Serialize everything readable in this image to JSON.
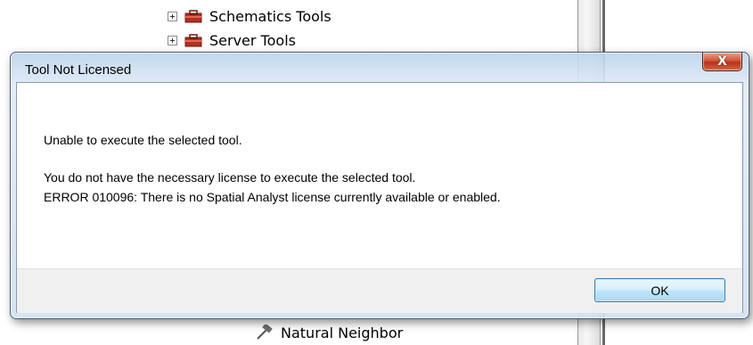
{
  "background": {
    "tree_items": [
      {
        "label": "Schematics Tools",
        "icon": "toolbox-icon"
      },
      {
        "label": "Server Tools",
        "icon": "toolbox-icon"
      },
      {
        "label": "Natural Neighbor",
        "icon": "hammer-icon"
      }
    ]
  },
  "dialog": {
    "title": "Tool Not Licensed",
    "close_label": "X",
    "message_line1": "Unable to execute the selected tool.",
    "message_line2": "You do not have the necessary license to execute the selected tool.",
    "message_line3": "ERROR 010096: There is no Spatial Analyst license currently available or enabled.",
    "ok_label": "OK"
  },
  "colors": {
    "close_button": "#c8452a",
    "title_bar": "#c9dcef",
    "ok_button": "#bee6fd"
  }
}
